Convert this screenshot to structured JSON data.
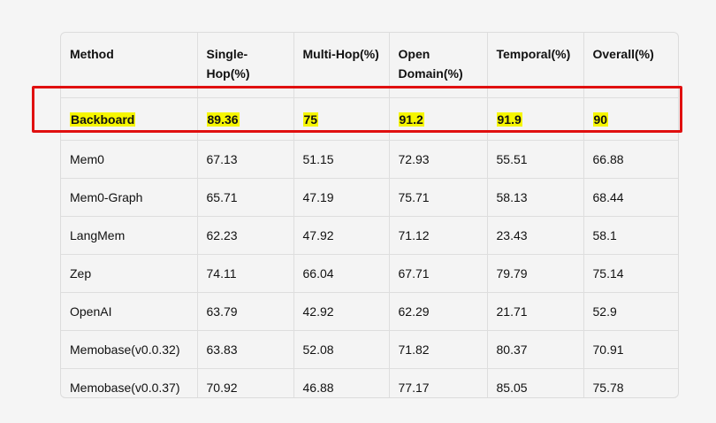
{
  "chart_data": {
    "type": "table",
    "columns": [
      "Method",
      "Single-Hop(%)",
      "Multi-Hop(%)",
      "Open Domain(%)",
      "Temporal(%)",
      "Overall(%)"
    ],
    "highlighted_row_index": 0,
    "rows": [
      [
        "Backboard",
        "89.36",
        "75",
        "91.2",
        "91.9",
        "90"
      ],
      [
        "Mem0",
        "67.13",
        "51.15",
        "72.93",
        "55.51",
        "66.88"
      ],
      [
        "Mem0-Graph",
        "65.71",
        "47.19",
        "75.71",
        "58.13",
        "68.44"
      ],
      [
        "LangMem",
        "62.23",
        "47.92",
        "71.12",
        "23.43",
        "58.1"
      ],
      [
        "Zep",
        "74.11",
        "66.04",
        "67.71",
        "79.79",
        "75.14"
      ],
      [
        "OpenAI",
        "63.79",
        "42.92",
        "62.29",
        "21.71",
        "52.9"
      ],
      [
        "Memobase(v0.0.32)",
        "63.83",
        "52.08",
        "71.82",
        "80.37",
        "70.91"
      ],
      [
        "Memobase(v0.0.37)",
        "70.92",
        "46.88",
        "77.17",
        "85.05",
        "75.78"
      ]
    ],
    "colors": {
      "highlight_text_bg": "#f6f600",
      "highlight_box": "#e01010"
    }
  }
}
